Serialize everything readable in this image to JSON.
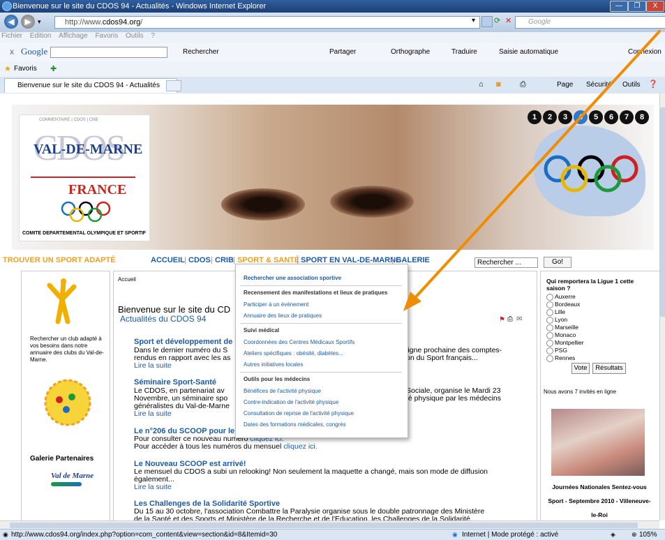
{
  "window": {
    "title": "Bienvenue sur le site du CDOS 94 - Actualités - Windows Internet Explorer",
    "min": "—",
    "max": "❐",
    "close": "X"
  },
  "addressbar": {
    "url_prefix": "http://www.",
    "url_domain": "cdos94.org",
    "url_suffix": "/",
    "search_placeholder": "Google"
  },
  "menubar": {
    "items": [
      "Fichier",
      "Edition",
      "Affichage",
      "Favoris",
      "Outils",
      "?"
    ]
  },
  "googlebar": {
    "close": "x",
    "brand": "Google",
    "rechercher": "Rechercher",
    "partager": "Partager",
    "orthographe": "Orthographe",
    "traduire": "Traduire",
    "saisie": "Saisie automatique",
    "connexion": "Connexion"
  },
  "favbar": {
    "favoris": "Favoris"
  },
  "tabbar": {
    "tab_title": "Bienvenue sur le site du CDOS 94 - Actualités",
    "page": "Page",
    "securite": "Sécurité",
    "outils": "Outils"
  },
  "banner": {
    "logo_top": "COMMENTAIRE | CDOS | CNB",
    "logo_big": "CDOS",
    "logo_vdm": "VAL-DE-MARNE",
    "logo_france": "FRANCE",
    "logo_comite": "COMITE DEPARTEMENTAL OLYMPIQUE ET SPORTIF",
    "numbers": [
      "1",
      "2",
      "3",
      "4",
      "5",
      "6",
      "7",
      "8"
    ]
  },
  "nav": {
    "trouver": "TROUVER UN SPORT ADAPTÉ",
    "items": [
      "ACCUEIL",
      "CDOS",
      "CRIB",
      "SPORT & SANTÉ",
      "SPORT EN VAL-DE-MARNE",
      "GALERIE"
    ],
    "search_placeholder": "Rechercher ...",
    "go": "Go!"
  },
  "left": {
    "club_text": [
      "Rechercher un club adapté à",
      "vos besoins dans notre",
      "annuaire des clubs du Val-de-",
      "Marne."
    ],
    "galerie": "Galerie Partenaires",
    "vdm_logo": "Val de Marne"
  },
  "main": {
    "breadcrumb": "Accueil",
    "welcome": "Bienvenue sur le site du CD",
    "subtitle": "Actualités du CDOS 94",
    "articles": [
      {
        "title": "Sport et développement de",
        "lines": [
          "Dans le dernier numéro du S",
          "rendus en rapport avec les as"
        ],
        "lines_right": [
          "ligne prochaine des comptes-",
          "on du Sport français..."
        ],
        "more": "Lire la suite"
      },
      {
        "title": "Séminaire Sport-Santé",
        "lines": [
          "Le CDOS, en partenariat av",
          "Novembre, un séminaire spo",
          "généralistes du Val-de-Marne"
        ],
        "lines_right": [
          "Sociale, organise le Mardi 23",
          "té physique par les médecins",
          ""
        ],
        "more": "Lire la suite"
      },
      {
        "title": "Le n°206 du SCOOP pour le",
        "lines": [
          "Pour consulter ce nouveau numéro",
          "Pour accéder à tous les numéros du mensuel"
        ],
        "links": [
          "cliquez ici.",
          "cliquez ici."
        ]
      },
      {
        "title": "Le Nouveau SCOOP est arrivé!",
        "lines": [
          "Le mensuel du CDOS a subi un relooking! Non seulement la maquette a changé, mais son mode de diffusion",
          "également..."
        ],
        "more": "Lire la suite"
      },
      {
        "title": "Les Challenges de la Solidarité Sportive",
        "lines": [
          "Du 15 au 30 octobre, l'association Combattre la Paralysie organise sous le double patronnage des Ministère",
          "de la Santé et des Sports et Ministère de la Recherche et de l'Education, les Challenges de la Solidarité"
        ]
      }
    ]
  },
  "dropdown": {
    "top_link": "Rechercher une association sportive",
    "section1": "Recensement des manifestations et lieux de pratiques",
    "s1_links": [
      "Participer à un évènement",
      "Annuaire des lieux de pratiques"
    ],
    "section2": "Suivi médical",
    "s2_links": [
      "Coordonnées des Centres Médicaux Sportifs",
      "Ateliers spécifiques : obésité, diabètes...",
      "Autres initiatives locales"
    ],
    "section3": "Outils pour les médecins",
    "s3_links": [
      "Bénéfices de l'activité physique",
      "Contre-indication de l'activité physique",
      "Consultation de reprise de l'activité physique",
      "Dates des formations médicales, congrès"
    ]
  },
  "right": {
    "poll_q1": "Qui remportera la Ligue 1 cette",
    "poll_q2": "saison ?",
    "options": [
      "Auxerre",
      "Bordeaux",
      "Lille",
      "Lyon",
      "Marseille",
      "Monaco",
      "Montpellier",
      "PSG",
      "Rennes"
    ],
    "vote": "Vote",
    "resultats": "Résultats",
    "online": "Nous avons 7 invités en ligne",
    "caption": [
      "Journées Nationales Sentez-vous",
      "Sport - Septembre 2010 - Villeneuve-",
      "le-Roi"
    ]
  },
  "status": {
    "url": "http://www.cdos94.org/index.php?option=com_content&view=section&id=8&Itemid=30",
    "zone": "Internet | Mode protégé : activé",
    "zoom": "105%"
  },
  "colors": {
    "accent": "#f08c00",
    "link": "#1a5aa8",
    "orange_nav": "#f0a020"
  }
}
